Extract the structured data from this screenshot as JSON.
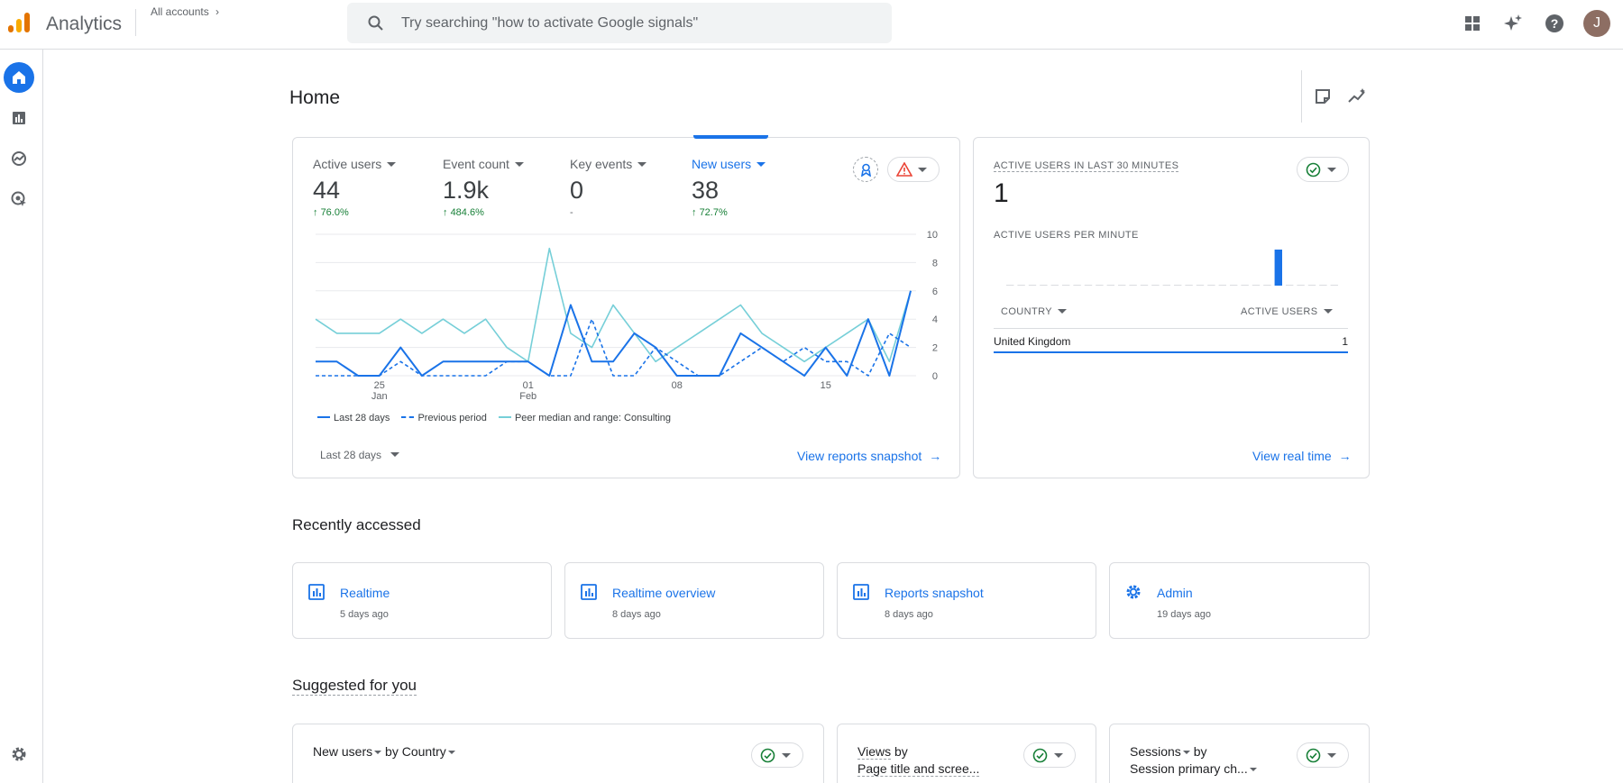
{
  "app": {
    "title": "Analytics",
    "account_link": "All accounts"
  },
  "search": {
    "placeholder": "Try searching \"how to activate Google signals\""
  },
  "user": {
    "avatar_initial": "J"
  },
  "page": {
    "title": "Home"
  },
  "metrics": [
    {
      "label": "Active users",
      "value": "44",
      "change": "76.0%"
    },
    {
      "label": "Event count",
      "value": "1.9k",
      "change": "484.6%"
    },
    {
      "label": "Key events",
      "value": "0",
      "change": "-"
    },
    {
      "label": "New users",
      "value": "38",
      "change": "72.7%"
    }
  ],
  "chart_data": {
    "type": "line",
    "ylim": [
      0,
      10
    ],
    "y_ticks": [
      "0",
      "2",
      "4",
      "6",
      "8",
      "10"
    ],
    "x_ticks": [
      {
        "label": "25",
        "sub": "Jan"
      },
      {
        "label": "01",
        "sub": "Feb"
      },
      {
        "label": "08",
        "sub": ""
      },
      {
        "label": "15",
        "sub": ""
      }
    ],
    "x_tick_index": [
      3,
      10,
      17,
      24
    ],
    "grid": true,
    "series": [
      {
        "name": "Last 28 days",
        "style": "solid",
        "color": "#1a73e8",
        "values": [
          1,
          1,
          0,
          0,
          2,
          0,
          1,
          1,
          1,
          1,
          1,
          0,
          5,
          1,
          1,
          3,
          2,
          0,
          0,
          0,
          3,
          2,
          1,
          0,
          2,
          0,
          4,
          0,
          6
        ]
      },
      {
        "name": "Previous period",
        "style": "dashed",
        "color": "#1a73e8",
        "values": [
          0,
          0,
          0,
          0,
          1,
          0,
          0,
          0,
          0,
          1,
          1,
          0,
          0,
          4,
          0,
          0,
          2,
          1,
          0,
          0,
          1,
          2,
          1,
          2,
          1,
          1,
          0,
          3,
          2
        ]
      },
      {
        "name": "Peer median and range: Consulting",
        "style": "solid",
        "color": "#76cfd8",
        "values": [
          4,
          3,
          3,
          3,
          4,
          3,
          4,
          3,
          4,
          2,
          1,
          9,
          3,
          2,
          5,
          3,
          1,
          2,
          3,
          4,
          5,
          3,
          2,
          1,
          2,
          3,
          4,
          1,
          6
        ]
      }
    ]
  },
  "overview": {
    "range_label": "Last 28 days",
    "snapshot_link": "View reports snapshot"
  },
  "realtime": {
    "title": "ACTIVE USERS IN LAST 30 MINUTES",
    "value": "1",
    "per_minute_label": "ACTIVE USERS PER MINUTE",
    "per_minute_values": [
      0,
      0,
      0,
      0,
      0,
      0,
      0,
      0,
      0,
      0,
      0,
      0,
      0,
      0,
      0,
      0,
      0,
      0,
      0,
      0,
      0,
      0,
      0,
      0,
      1,
      0,
      0,
      0,
      0,
      0
    ],
    "col_country": "COUNTRY",
    "col_users": "ACTIVE USERS",
    "rows": [
      {
        "country": "United Kingdom",
        "users": "1"
      }
    ],
    "link": "View real time"
  },
  "recent": {
    "title": "Recently accessed",
    "items": [
      {
        "name": "Realtime",
        "time": "5 days ago",
        "icon": "report-icon"
      },
      {
        "name": "Realtime overview",
        "time": "8 days ago",
        "icon": "report-icon"
      },
      {
        "name": "Reports snapshot",
        "time": "8 days ago",
        "icon": "report-icon"
      },
      {
        "name": "Admin",
        "time": "19 days ago",
        "icon": "gear-icon"
      }
    ]
  },
  "suggested": {
    "title": "Suggested for you",
    "cards": [
      {
        "metric": "New users",
        "by": "by",
        "dim": "Country"
      },
      {
        "metric": "Views",
        "by": "by",
        "dim": "Page title and scree..."
      },
      {
        "metric": "Sessions",
        "by": "by",
        "dim": "Session primary ch..."
      }
    ]
  },
  "colors": {
    "accent": "#1a73e8",
    "positive": "#188038",
    "peer": "#76cfd8",
    "logo_orange": "#f9ab00",
    "logo_dark": "#e37400"
  }
}
